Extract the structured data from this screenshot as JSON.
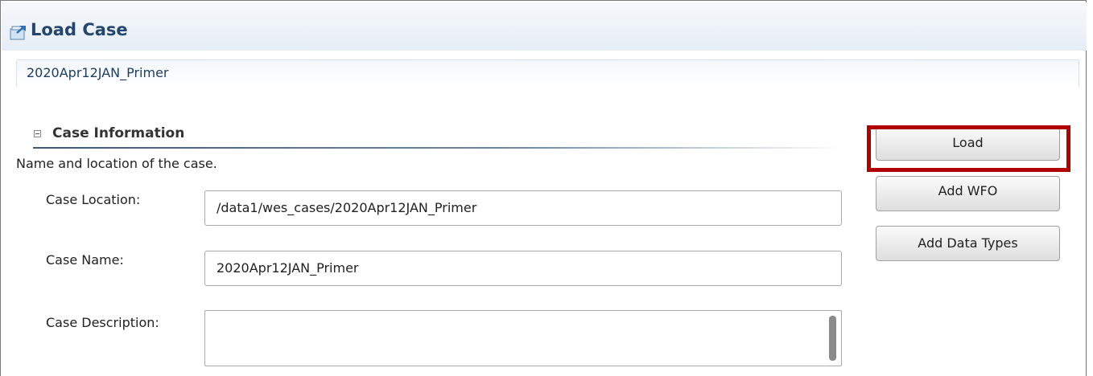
{
  "window": {
    "title": "Load Case",
    "title_icon": "load-case-icon"
  },
  "case_tab": {
    "title": "2020Apr12JAN_Primer"
  },
  "section": {
    "title": "Case Information",
    "toggle_icon": "collapse-minus-icon",
    "description": "Name and location of the case."
  },
  "fields": {
    "case_location": {
      "label": "Case Location:",
      "value": "/data1/wes_cases/2020Apr12JAN_Primer"
    },
    "case_name": {
      "label": "Case Name:",
      "value": "2020Apr12JAN_Primer"
    },
    "case_description": {
      "label": "Case Description:",
      "value": ""
    }
  },
  "buttons": {
    "load": "Load",
    "add_wfo": "Add WFO",
    "add_data_types": "Add Data Types"
  },
  "colors": {
    "highlight": "#b00000",
    "title_text": "#23466e"
  }
}
